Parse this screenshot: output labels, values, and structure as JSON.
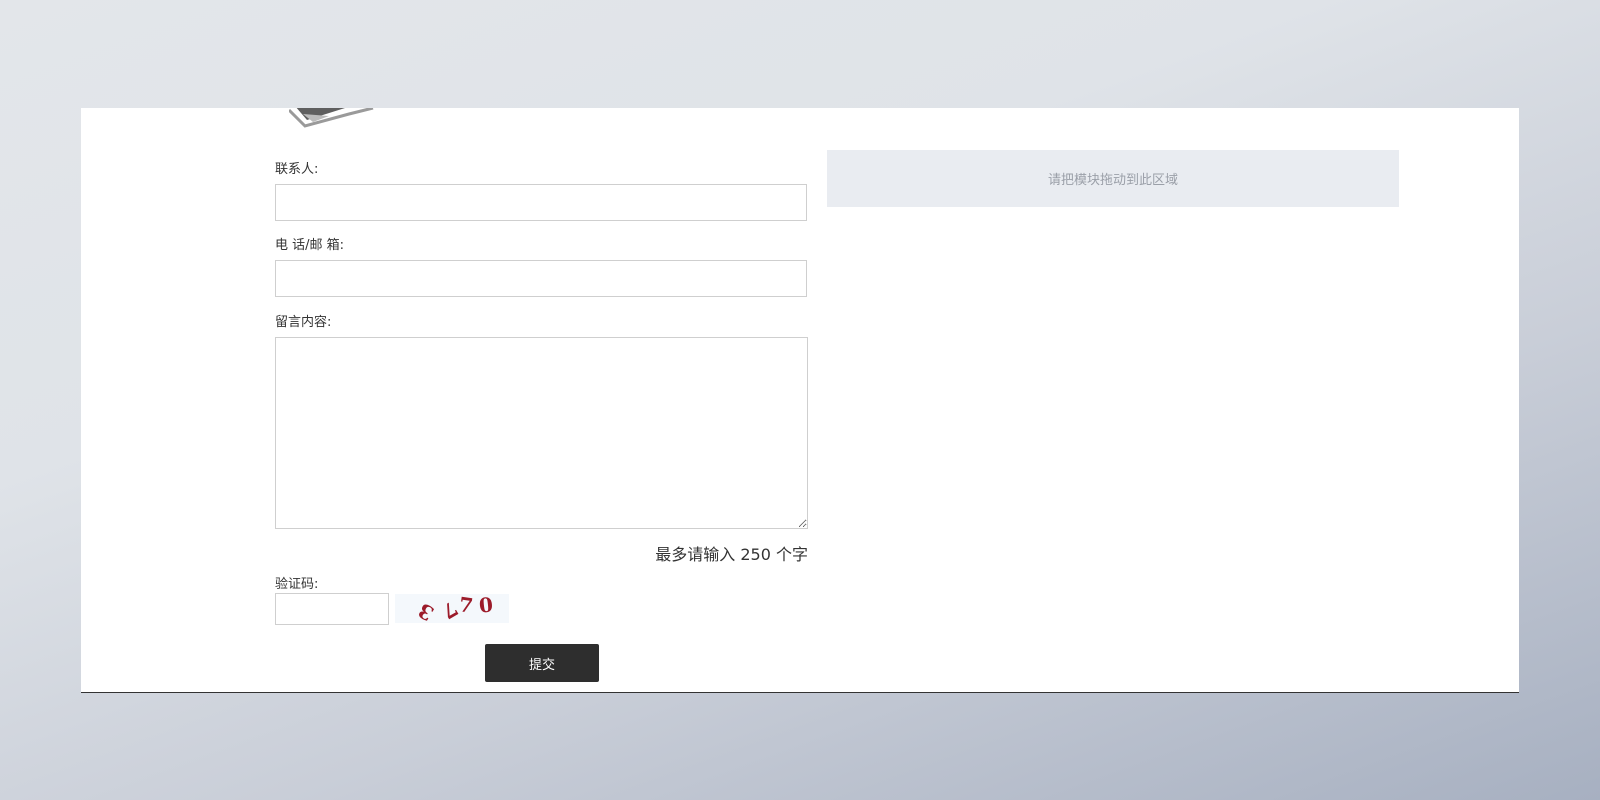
{
  "form": {
    "contact_label": "联系人:",
    "contact_value": "",
    "phone_label": "电 话/邮 箱:",
    "phone_value": "",
    "message_label": "留言内容:",
    "message_value": "",
    "char_limit_hint": "最多请输入 250 个字",
    "captcha_label": "验证码:",
    "captcha_value": "",
    "captcha_chars": [
      "3",
      "7",
      "7",
      "0"
    ],
    "submit_label": "提交"
  },
  "drop_zone": {
    "text": "请把模块拖动到此区域"
  },
  "floating_buttons": [
    {
      "icon": "widgets-icon"
    },
    {
      "icon": "document-icon"
    },
    {
      "icon": "layers-icon"
    }
  ],
  "colors": {
    "button_bg": "#2e2e2e",
    "captcha_text": "#9c1b2a",
    "drop_zone_bg": "#e9ecf1"
  }
}
